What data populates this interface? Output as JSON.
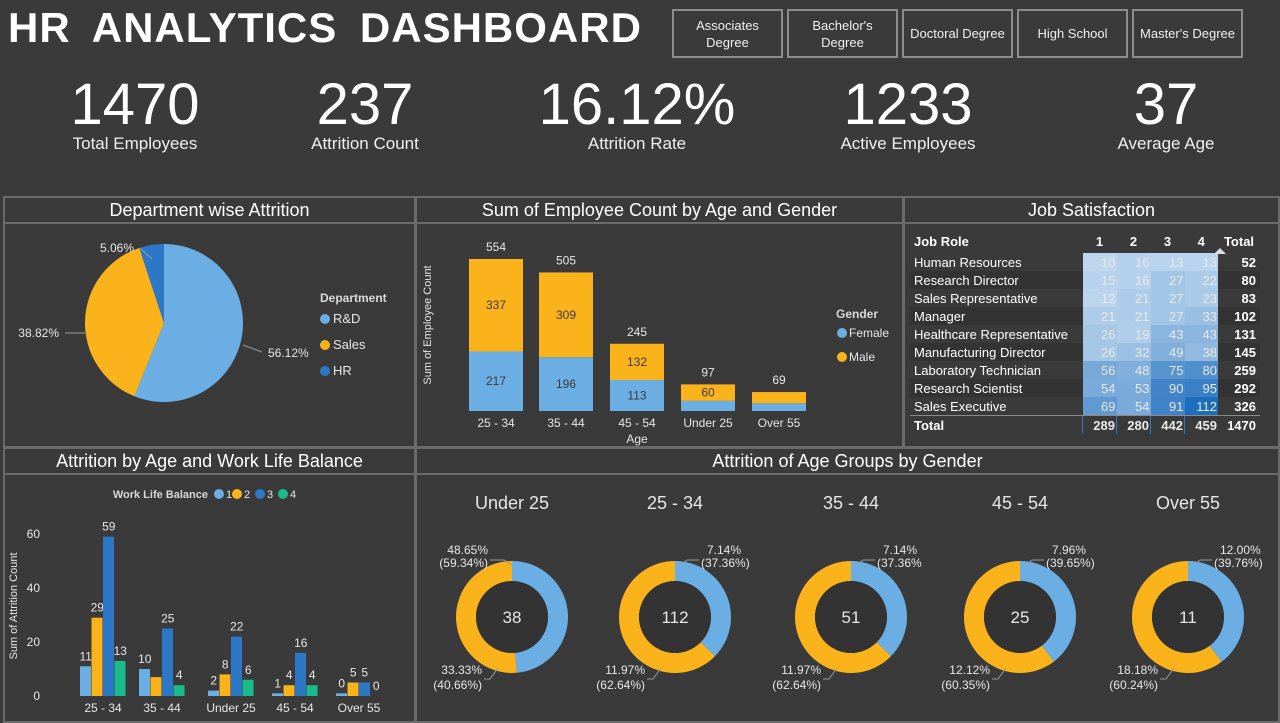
{
  "header": {
    "title": "HR ANALYTICS DASHBOARD"
  },
  "filters": [
    "Associates Degree",
    "Bachelor's Degree",
    "Doctoral Degree",
    "High School",
    "Master's Degree"
  ],
  "kpis": [
    {
      "value": "1470",
      "label": "Total Employees"
    },
    {
      "value": "237",
      "label": "Attrition Count"
    },
    {
      "value": "16.12%",
      "label": "Attrition Rate"
    },
    {
      "value": "1233",
      "label": "Active Employees"
    },
    {
      "value": "37",
      "label": "Average Age"
    }
  ],
  "colors": {
    "blue": "#6aaee3",
    "yellow": "#fbb31b",
    "darkblue": "#2c78c7",
    "green": "#1abc8c"
  },
  "panels": {
    "dept": "Department wise Attrition",
    "ageGender": "Sum of Employee Count by Age and Gender",
    "jobSat": "Job Satisfaction",
    "wlb": "Attrition by Age and Work Life Balance",
    "ageGroups": "Attrition of Age Groups by Gender"
  },
  "chart_data": [
    {
      "type": "pie",
      "title": "Department wise Attrition",
      "legend_title": "Department",
      "legend_placement": "right",
      "slices": [
        {
          "label": "R&D",
          "value": 56.12,
          "display": "56.12%",
          "color": "#6aaee3"
        },
        {
          "label": "Sales",
          "value": 38.82,
          "display": "38.82%",
          "color": "#fbb31b"
        },
        {
          "label": "HR",
          "value": 5.06,
          "display": "5.06%",
          "color": "#2c78c7"
        }
      ]
    },
    {
      "type": "bar",
      "stacked": true,
      "title": "Sum of Employee Count by Age and Gender",
      "xlabel": "Age",
      "ylabel": "Sum of Employee Count",
      "legend_title": "Gender",
      "legend_placement": "right",
      "categories": [
        "25 - 34",
        "35 - 44",
        "45 - 54",
        "Under 25",
        "Over 55"
      ],
      "series": [
        {
          "name": "Female",
          "color": "#6aaee3",
          "values": [
            217,
            196,
            113,
            37,
            28
          ],
          "labels": [
            "217",
            "196",
            "113",
            "",
            ""
          ]
        },
        {
          "name": "Male",
          "color": "#fbb31b",
          "values": [
            337,
            309,
            132,
            60,
            41
          ],
          "labels": [
            "337",
            "309",
            "132",
            "60",
            ""
          ]
        }
      ],
      "totals": [
        554,
        505,
        245,
        97,
        69
      ]
    },
    {
      "type": "table",
      "title": "Job Satisfaction",
      "columns": [
        "Job Role",
        "1",
        "2",
        "3",
        "4",
        "Total"
      ],
      "rows": [
        {
          "role": "Human Resources",
          "values": [
            10,
            16,
            13,
            13
          ],
          "total": 52
        },
        {
          "role": "Research Director",
          "values": [
            15,
            16,
            27,
            22
          ],
          "total": 80
        },
        {
          "role": "Sales Representative",
          "values": [
            12,
            21,
            27,
            23
          ],
          "total": 83
        },
        {
          "role": "Manager",
          "values": [
            21,
            21,
            27,
            33
          ],
          "total": 102
        },
        {
          "role": "Healthcare Representative",
          "values": [
            26,
            19,
            43,
            43
          ],
          "total": 131
        },
        {
          "role": "Manufacturing Director",
          "values": [
            26,
            32,
            49,
            38
          ],
          "total": 145
        },
        {
          "role": "Laboratory Technician",
          "values": [
            56,
            48,
            75,
            80
          ],
          "total": 259
        },
        {
          "role": "Research Scientist",
          "values": [
            54,
            53,
            90,
            95
          ],
          "total": 292
        },
        {
          "role": "Sales Executive",
          "values": [
            69,
            54,
            91,
            112
          ],
          "total": 326
        }
      ],
      "total_row": {
        "role": "Total",
        "values": [
          289,
          280,
          442,
          459
        ],
        "total": 1470
      }
    },
    {
      "type": "bar",
      "title": "Attrition by Age and Work Life Balance",
      "ylabel": "Sum of Attrition Count",
      "legend_title": "Work Life Balance",
      "legend_placement": "top",
      "ylim": [
        0,
        65
      ],
      "yticks": [
        0,
        20,
        40,
        60
      ],
      "categories": [
        "25 - 34",
        "35 - 44",
        "Under 25",
        "45 - 54",
        "Over 55"
      ],
      "series": [
        {
          "name": "1",
          "color": "#6aaee3",
          "values": [
            11,
            10,
            2,
            1,
            1
          ]
        },
        {
          "name": "2",
          "color": "#fbb31b",
          "values": [
            29,
            7,
            8,
            4,
            5
          ]
        },
        {
          "name": "3",
          "color": "#2c78c7",
          "values": [
            59,
            25,
            22,
            16,
            5
          ]
        },
        {
          "name": "4",
          "color": "#1abc8c",
          "values": [
            13,
            4,
            6,
            4,
            0
          ]
        }
      ],
      "labels": [
        [
          "11",
          "29",
          "59",
          "13"
        ],
        [
          "10",
          "",
          "25",
          "4"
        ],
        [
          "2",
          "8",
          "22",
          "6"
        ],
        [
          "1",
          "4",
          "16",
          "4"
        ],
        [
          "0",
          "5",
          "5",
          "0"
        ]
      ]
    },
    {
      "type": "pie",
      "subtype": "donut",
      "title": "Attrition of Age Groups by Gender",
      "groups": [
        {
          "name": "Under 25",
          "center": "38",
          "female": 48.65,
          "male": 51.35,
          "female_label": "48.65%",
          "female_sub": "(59.34%)",
          "male_label": "33.33%",
          "male_sub": "(40.66%)"
        },
        {
          "name": "25 - 34",
          "center": "112",
          "female": 37.36,
          "male": 62.64,
          "female_label": "7.14%",
          "female_sub": "(37.36%)",
          "male_label": "11.97%",
          "male_sub": "(62.64%)"
        },
        {
          "name": "35 - 44",
          "center": "51",
          "female": 37.36,
          "male": 62.64,
          "female_label": "7.14%",
          "female_sub": "(37.36%",
          "male_label": "11.97%",
          "male_sub": "(62.64%)"
        },
        {
          "name": "45 - 54",
          "center": "25",
          "female": 39.65,
          "male": 60.35,
          "female_label": "7.96%",
          "female_sub": "(39.65%)",
          "male_label": "12.12%",
          "male_sub": "(60.35%)"
        },
        {
          "name": "Over 55",
          "center": "11",
          "female": 39.76,
          "male": 60.24,
          "female_label": "12.00%",
          "female_sub": "(39.76%)",
          "male_label": "18.18%",
          "male_sub": "(60.24%)"
        }
      ]
    }
  ]
}
